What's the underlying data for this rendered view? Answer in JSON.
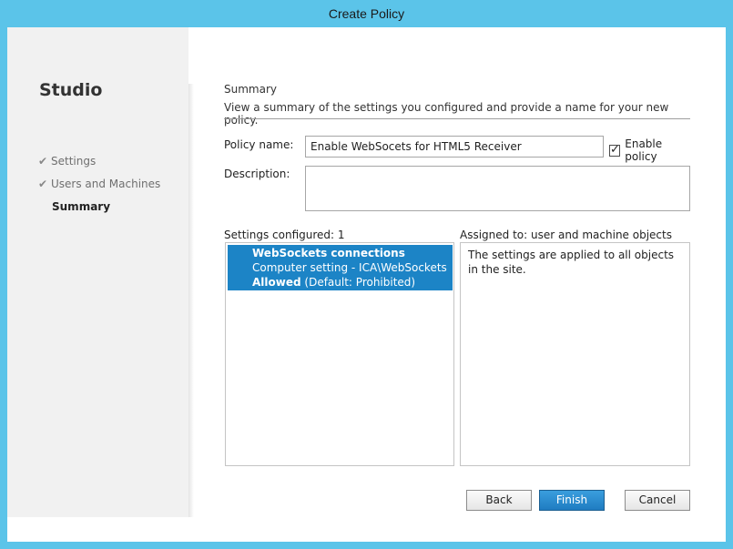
{
  "window": {
    "title": "Create Policy"
  },
  "sidebar": {
    "brand": "Studio",
    "steps": [
      {
        "label": "Settings",
        "done": true
      },
      {
        "label": "Users and Machines",
        "done": true
      },
      {
        "label": "Summary",
        "done": false,
        "current": true
      }
    ],
    "check_glyph": "✔"
  },
  "summary": {
    "heading": "Summary",
    "description": "View a summary of the settings you configured and provide a name for your new policy."
  },
  "form": {
    "policy_name_label": "Policy name:",
    "policy_name_value": "Enable WebSocets for HTML5 Receiver",
    "enable_policy_label": "Enable policy",
    "enable_policy_checked": true,
    "description_label": "Description:",
    "description_value": ""
  },
  "settings": {
    "label": "Settings configured: 1",
    "items": [
      {
        "name": "WebSockets connections",
        "path": "Computer setting - ICA\\WebSockets",
        "value": "Allowed",
        "default": "(Default: Prohibited)"
      }
    ]
  },
  "assigned": {
    "label": "Assigned to:  user and machine objects",
    "text": "The settings are applied to all objects in the site."
  },
  "buttons": {
    "back": "Back",
    "finish": "Finish",
    "cancel": "Cancel"
  },
  "colors": {
    "accent": "#1c84c6",
    "titlebar": "#5bc4e9",
    "sidebar": "#f1f1f1"
  }
}
